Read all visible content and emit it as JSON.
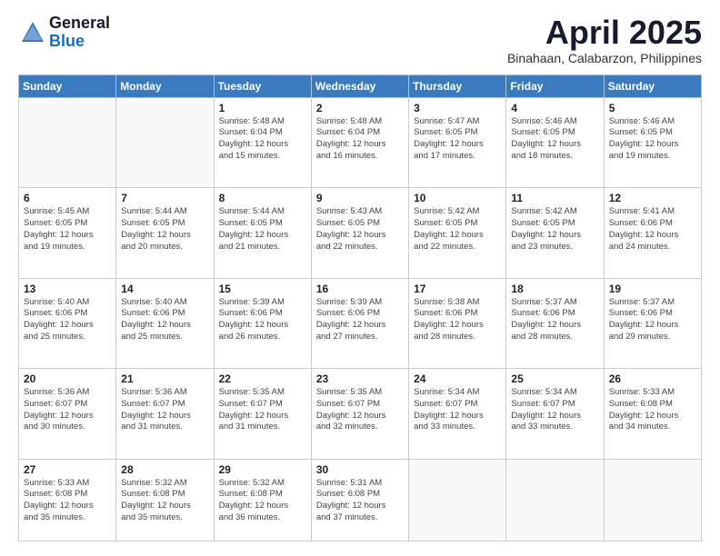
{
  "logo": {
    "general": "General",
    "blue": "Blue"
  },
  "title": {
    "month_year": "April 2025",
    "location": "Binahaan, Calabarzon, Philippines"
  },
  "weekdays": [
    "Sunday",
    "Monday",
    "Tuesday",
    "Wednesday",
    "Thursday",
    "Friday",
    "Saturday"
  ],
  "weeks": [
    [
      {
        "day": "",
        "info": ""
      },
      {
        "day": "",
        "info": ""
      },
      {
        "day": "1",
        "info": "Sunrise: 5:48 AM\nSunset: 6:04 PM\nDaylight: 12 hours\nand 15 minutes."
      },
      {
        "day": "2",
        "info": "Sunrise: 5:48 AM\nSunset: 6:04 PM\nDaylight: 12 hours\nand 16 minutes."
      },
      {
        "day": "3",
        "info": "Sunrise: 5:47 AM\nSunset: 6:05 PM\nDaylight: 12 hours\nand 17 minutes."
      },
      {
        "day": "4",
        "info": "Sunrise: 5:46 AM\nSunset: 6:05 PM\nDaylight: 12 hours\nand 18 minutes."
      },
      {
        "day": "5",
        "info": "Sunrise: 5:46 AM\nSunset: 6:05 PM\nDaylight: 12 hours\nand 19 minutes."
      }
    ],
    [
      {
        "day": "6",
        "info": "Sunrise: 5:45 AM\nSunset: 6:05 PM\nDaylight: 12 hours\nand 19 minutes."
      },
      {
        "day": "7",
        "info": "Sunrise: 5:44 AM\nSunset: 6:05 PM\nDaylight: 12 hours\nand 20 minutes."
      },
      {
        "day": "8",
        "info": "Sunrise: 5:44 AM\nSunset: 6:05 PM\nDaylight: 12 hours\nand 21 minutes."
      },
      {
        "day": "9",
        "info": "Sunrise: 5:43 AM\nSunset: 6:05 PM\nDaylight: 12 hours\nand 22 minutes."
      },
      {
        "day": "10",
        "info": "Sunrise: 5:42 AM\nSunset: 6:05 PM\nDaylight: 12 hours\nand 22 minutes."
      },
      {
        "day": "11",
        "info": "Sunrise: 5:42 AM\nSunset: 6:05 PM\nDaylight: 12 hours\nand 23 minutes."
      },
      {
        "day": "12",
        "info": "Sunrise: 5:41 AM\nSunset: 6:06 PM\nDaylight: 12 hours\nand 24 minutes."
      }
    ],
    [
      {
        "day": "13",
        "info": "Sunrise: 5:40 AM\nSunset: 6:06 PM\nDaylight: 12 hours\nand 25 minutes."
      },
      {
        "day": "14",
        "info": "Sunrise: 5:40 AM\nSunset: 6:06 PM\nDaylight: 12 hours\nand 25 minutes."
      },
      {
        "day": "15",
        "info": "Sunrise: 5:39 AM\nSunset: 6:06 PM\nDaylight: 12 hours\nand 26 minutes."
      },
      {
        "day": "16",
        "info": "Sunrise: 5:39 AM\nSunset: 6:06 PM\nDaylight: 12 hours\nand 27 minutes."
      },
      {
        "day": "17",
        "info": "Sunrise: 5:38 AM\nSunset: 6:06 PM\nDaylight: 12 hours\nand 28 minutes."
      },
      {
        "day": "18",
        "info": "Sunrise: 5:37 AM\nSunset: 6:06 PM\nDaylight: 12 hours\nand 28 minutes."
      },
      {
        "day": "19",
        "info": "Sunrise: 5:37 AM\nSunset: 6:06 PM\nDaylight: 12 hours\nand 29 minutes."
      }
    ],
    [
      {
        "day": "20",
        "info": "Sunrise: 5:36 AM\nSunset: 6:07 PM\nDaylight: 12 hours\nand 30 minutes."
      },
      {
        "day": "21",
        "info": "Sunrise: 5:36 AM\nSunset: 6:07 PM\nDaylight: 12 hours\nand 31 minutes."
      },
      {
        "day": "22",
        "info": "Sunrise: 5:35 AM\nSunset: 6:07 PM\nDaylight: 12 hours\nand 31 minutes."
      },
      {
        "day": "23",
        "info": "Sunrise: 5:35 AM\nSunset: 6:07 PM\nDaylight: 12 hours\nand 32 minutes."
      },
      {
        "day": "24",
        "info": "Sunrise: 5:34 AM\nSunset: 6:07 PM\nDaylight: 12 hours\nand 33 minutes."
      },
      {
        "day": "25",
        "info": "Sunrise: 5:34 AM\nSunset: 6:07 PM\nDaylight: 12 hours\nand 33 minutes."
      },
      {
        "day": "26",
        "info": "Sunrise: 5:33 AM\nSunset: 6:08 PM\nDaylight: 12 hours\nand 34 minutes."
      }
    ],
    [
      {
        "day": "27",
        "info": "Sunrise: 5:33 AM\nSunset: 6:08 PM\nDaylight: 12 hours\nand 35 minutes."
      },
      {
        "day": "28",
        "info": "Sunrise: 5:32 AM\nSunset: 6:08 PM\nDaylight: 12 hours\nand 35 minutes."
      },
      {
        "day": "29",
        "info": "Sunrise: 5:32 AM\nSunset: 6:08 PM\nDaylight: 12 hours\nand 36 minutes."
      },
      {
        "day": "30",
        "info": "Sunrise: 5:31 AM\nSunset: 6:08 PM\nDaylight: 12 hours\nand 37 minutes."
      },
      {
        "day": "",
        "info": ""
      },
      {
        "day": "",
        "info": ""
      },
      {
        "day": "",
        "info": ""
      }
    ]
  ]
}
